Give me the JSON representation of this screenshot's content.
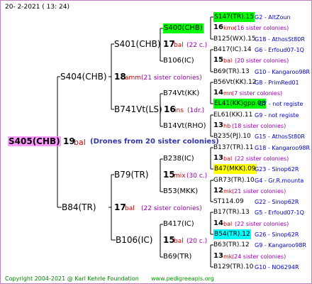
{
  "header": {
    "date": "20-  2-2021  ( 13:  24)"
  },
  "footer": {
    "copyright": "Copyright 2004-2021 @ Karl Kehrle Foundation",
    "site": "www.pedigreeapis.org"
  },
  "root": {
    "name": "S405(CHB)",
    "num": "19",
    "abbr": "bal",
    "note": "(Drones from 20 sister colonies)",
    "color": "#ff99ff"
  },
  "gen1": [
    {
      "name": "S404(CHB)",
      "num": "18",
      "abbr": "amm",
      "note": "(21 sister colonies)"
    },
    {
      "name": "B84(TR)",
      "num": "17",
      "abbr": "bal",
      "note": "(22 sister colonies)"
    }
  ],
  "gen2": [
    {
      "name": "S401(CHB)",
      "num": "17",
      "abbr": "bal",
      "note": "(22 c.)"
    },
    {
      "name": "B741Vt(LS)",
      "num": "16",
      "abbr": "ins",
      "note": "(1dr.)"
    },
    {
      "name": "B79(TR)",
      "num": "15",
      "abbr": "mix",
      "note": "(30 c.)"
    },
    {
      "name": "B106(IC)",
      "num": "15",
      "abbr": "bal",
      "note": "(20 c.)"
    }
  ],
  "gen3": [
    {
      "name": "S400(CHB)",
      "highlight": "#00ff00"
    },
    {
      "name": "B106(IC)"
    },
    {
      "name": "B74Vt(KK)"
    },
    {
      "name": "B14Vt(RHO)"
    },
    {
      "name": "B238(IC)"
    },
    {
      "name": "B53(MKK)"
    },
    {
      "name": "B417(IC)"
    },
    {
      "name": "B69(TR)"
    }
  ],
  "gen4": [
    {
      "name": "S147(TR).15",
      "info": "G2 - AltZoun",
      "highlight": "#00ff00"
    },
    {
      "num": "16",
      "abbr": "kmx",
      "note": "(16 sister colonies)"
    },
    {
      "name": "B125(WX).15",
      "info": "G18 - AthosSt80R"
    },
    {
      "name": "B417(IC).14",
      "info": "G6 - Erfoud07-1Q"
    },
    {
      "num": "15",
      "abbr": "bal",
      "note": "(20 sister colonies)"
    },
    {
      "name": "B69(TR).13",
      "info": "G10 - Kangaroo98R"
    },
    {
      "name": "B56Vt(KK).12",
      "info": "G8 - PrimRed01"
    },
    {
      "num": "14",
      "abbr": "mn",
      "note": "(7 sister colonies)"
    },
    {
      "name": "EL41(KK)gpp.08",
      "info": "G7 - not registe",
      "highlight": "#00ff00"
    },
    {
      "name": "EL61(KK).11",
      "info": "G9 - not registe"
    },
    {
      "num": "13",
      "abbr": "hb",
      "note": "(18 sister colonies)"
    },
    {
      "name": "B235(PJ).10",
      "info": "G15 - AthosSt80R"
    },
    {
      "name": "B137(TR).11",
      "info": "G18 - Kangaroo98R"
    },
    {
      "num": "13",
      "abbr": "bal",
      "note": "(22 sister colonies)"
    },
    {
      "name": "B47(MKK).09",
      "info": "G23 - Sinop62R",
      "highlight": "#ffff00"
    },
    {
      "name": "GR73(TR).10",
      "info": "G4 - Gr.R.mounta"
    },
    {
      "num": "12",
      "abbr": "mk",
      "note": "(21 sister colonies)"
    },
    {
      "name": "ST114.09",
      "info": "G22 - Sinop62R"
    },
    {
      "name": "B17(TR).13",
      "info": "G5 - Erfoud07-1Q"
    },
    {
      "num": "14",
      "abbr": "bal",
      "note": "(22 sister colonies)"
    },
    {
      "name": "B54(TR).12",
      "info": "G26 - Sinop62R",
      "highlight": "#00ffff"
    },
    {
      "name": "B63(TR).12",
      "info": "G9 - Kangaroo98R"
    },
    {
      "num": "13",
      "abbr": "mk",
      "note": "(24 sister colonies)"
    },
    {
      "name": "B129(TR).10",
      "info": "G10 - NO6294R"
    }
  ]
}
